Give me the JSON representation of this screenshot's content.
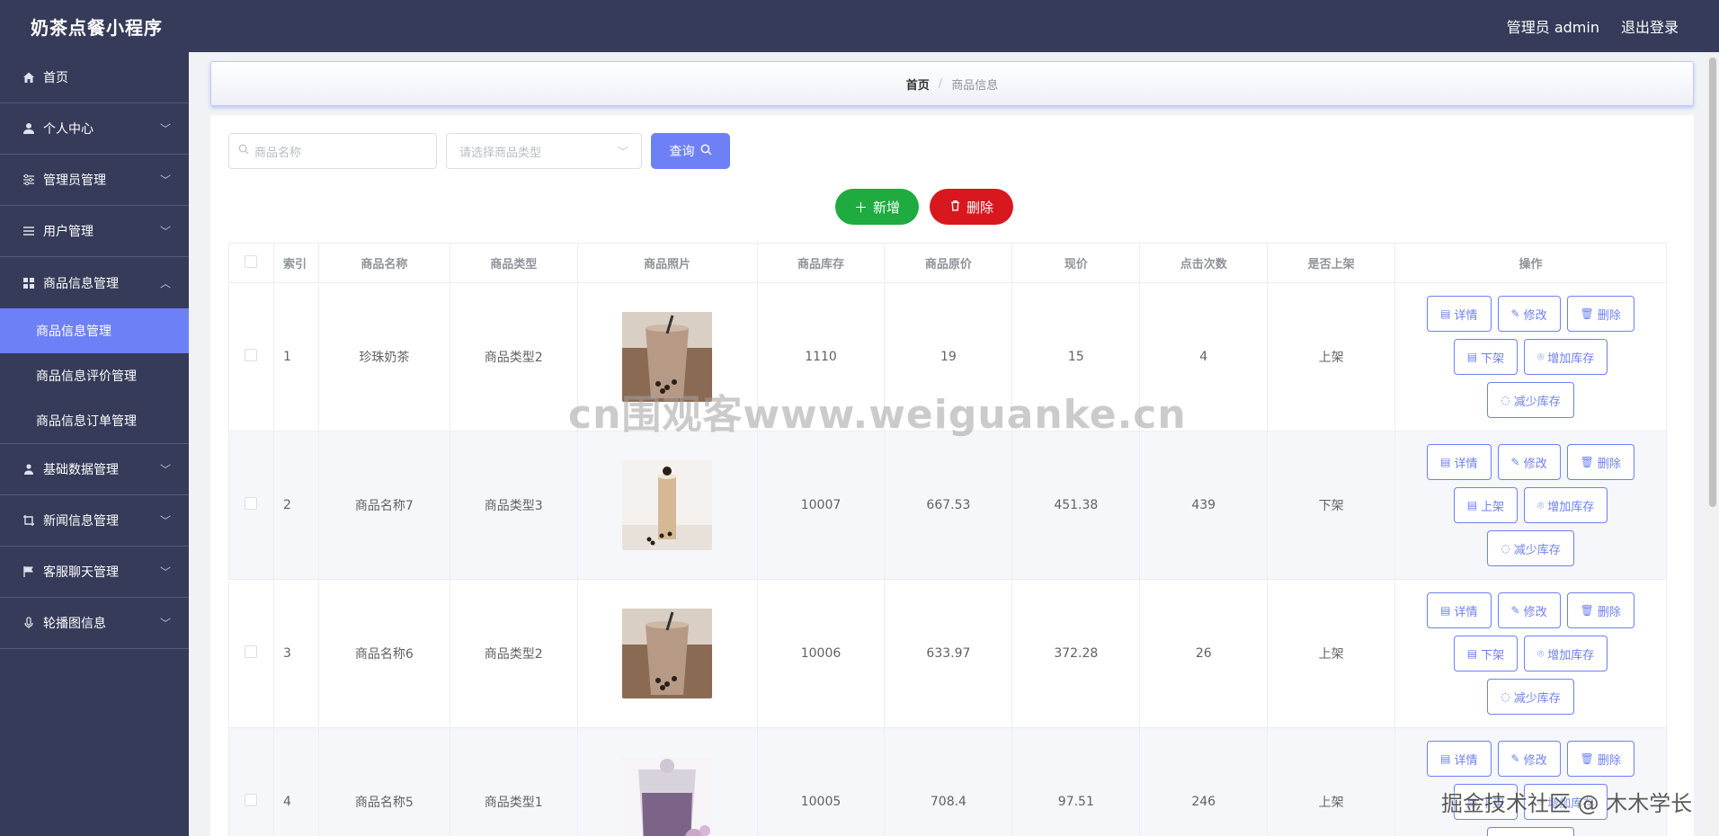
{
  "header": {
    "app_title": "奶茶点餐小程序",
    "admin_label": "管理员 admin",
    "logout_label": "退出登录"
  },
  "sidebar": {
    "items": [
      {
        "label": "首页",
        "icon": "home-icon",
        "expandable": false
      },
      {
        "label": "个人中心",
        "icon": "user-icon",
        "expandable": true
      },
      {
        "label": "管理员管理",
        "icon": "sliders-icon",
        "expandable": true
      },
      {
        "label": "用户管理",
        "icon": "list-icon",
        "expandable": true
      },
      {
        "label": "商品信息管理",
        "icon": "grid-icon",
        "expandable": true,
        "open": true
      },
      {
        "label": "基础数据管理",
        "icon": "person-icon",
        "expandable": true
      },
      {
        "label": "新闻信息管理",
        "icon": "crop-icon",
        "expandable": true
      },
      {
        "label": "客服聊天管理",
        "icon": "flag-icon",
        "expandable": true
      },
      {
        "label": "轮播图信息",
        "icon": "mic-icon",
        "expandable": true
      }
    ],
    "subitems": [
      {
        "label": "商品信息管理",
        "active": true
      },
      {
        "label": "商品信息评价管理",
        "active": false
      },
      {
        "label": "商品信息订单管理",
        "active": false
      }
    ]
  },
  "breadcrumb": {
    "home": "首页",
    "separator": "/",
    "current": "商品信息"
  },
  "search": {
    "name_placeholder": "商品名称",
    "type_placeholder": "请选择商品类型",
    "query_label": "查询"
  },
  "actions": {
    "add_label": "新增",
    "delete_label": "删除"
  },
  "table": {
    "headers": [
      "索引",
      "商品名称",
      "商品类型",
      "商品照片",
      "商品库存",
      "商品原价",
      "现价",
      "点击次数",
      "是否上架",
      "操作"
    ],
    "rows": [
      {
        "index": "1",
        "name": "珍珠奶茶",
        "type": "商品类型2",
        "stock": "1110",
        "original_price": "19",
        "price": "15",
        "clicks": "4",
        "status": "上架",
        "toggle_label": "下架"
      },
      {
        "index": "2",
        "name": "商品名称7",
        "type": "商品类型3",
        "stock": "10007",
        "original_price": "667.53",
        "price": "451.38",
        "clicks": "439",
        "status": "下架",
        "toggle_label": "上架"
      },
      {
        "index": "3",
        "name": "商品名称6",
        "type": "商品类型2",
        "stock": "10006",
        "original_price": "633.97",
        "price": "372.28",
        "clicks": "26",
        "status": "上架",
        "toggle_label": "下架"
      },
      {
        "index": "4",
        "name": "商品名称5",
        "type": "商品类型1",
        "stock": "10005",
        "original_price": "708.4",
        "price": "97.51",
        "clicks": "246",
        "status": "上架",
        "toggle_label": "下架"
      }
    ],
    "op_labels": {
      "detail": "详情",
      "edit": "修改",
      "delete": "删除",
      "add_stock": "增加库存",
      "reduce_stock": "减少库存"
    }
  },
  "watermarks": {
    "center": "cn围观客www.weiguanke.cn",
    "corner": "掘金技术社区 @ 木木学长"
  },
  "colors": {
    "header_bg": "#353b58",
    "accent": "#6e80f5",
    "add_green": "#1fab3f",
    "delete_red": "#d8171f"
  }
}
